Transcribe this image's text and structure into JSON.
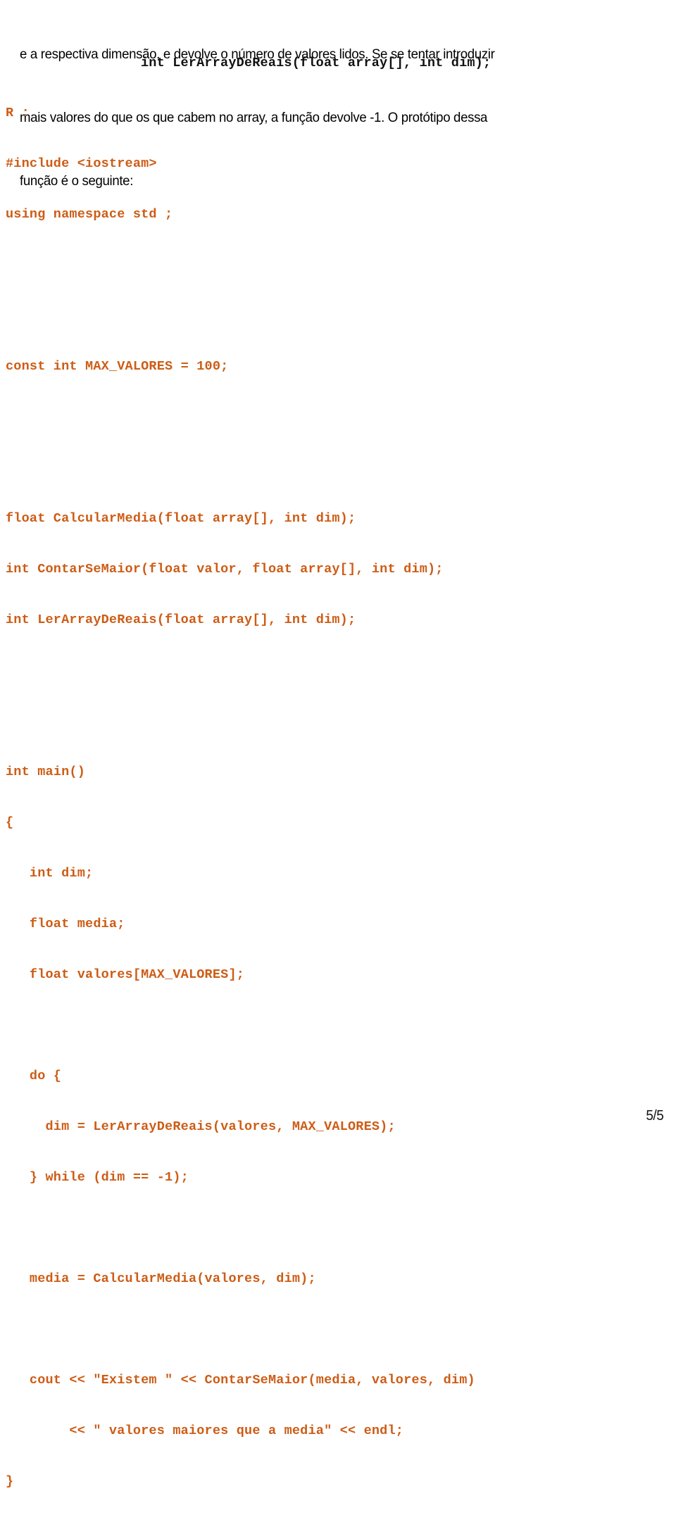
{
  "document": {
    "page_label": "5/5",
    "accent_color": "#cd5c15",
    "text_color": "#000000",
    "background_color": "#ffffff"
  },
  "prose": {
    "lines": [
      "e a respectiva dimensão, e devolve o número de valores lidos. Se se tentar introduzir",
      "mais valores do que os que cabem no array, a função devolve -1. O protótipo dessa",
      "função é o seguinte:"
    ]
  },
  "prototype": {
    "signature": "int LerArrayDeReais(float array[], int dim);"
  },
  "answer": {
    "label": "R :",
    "code_lines": [
      "#include <iostream>",
      "using namespace std ;",
      "",
      "",
      "const int MAX_VALORES = 100;",
      "",
      "",
      "float CalcularMedia(float array[], int dim);",
      "int ContarSeMaior(float valor, float array[], int dim);",
      "int LerArrayDeReais(float array[], int dim);",
      "",
      "",
      "int main()",
      "{",
      "   int dim;",
      "   float media;",
      "   float valores[MAX_VALORES];",
      "",
      "   do {",
      "     dim = LerArrayDeReais(valores, MAX_VALORES);",
      "   } while (dim == -1);",
      "",
      "   media = CalcularMedia(valores, dim);",
      "",
      "   cout << \"Existem \" << ContarSeMaior(media, valores, dim)",
      "        << \" valores maiores que a media\" << endl;",
      "}"
    ]
  }
}
